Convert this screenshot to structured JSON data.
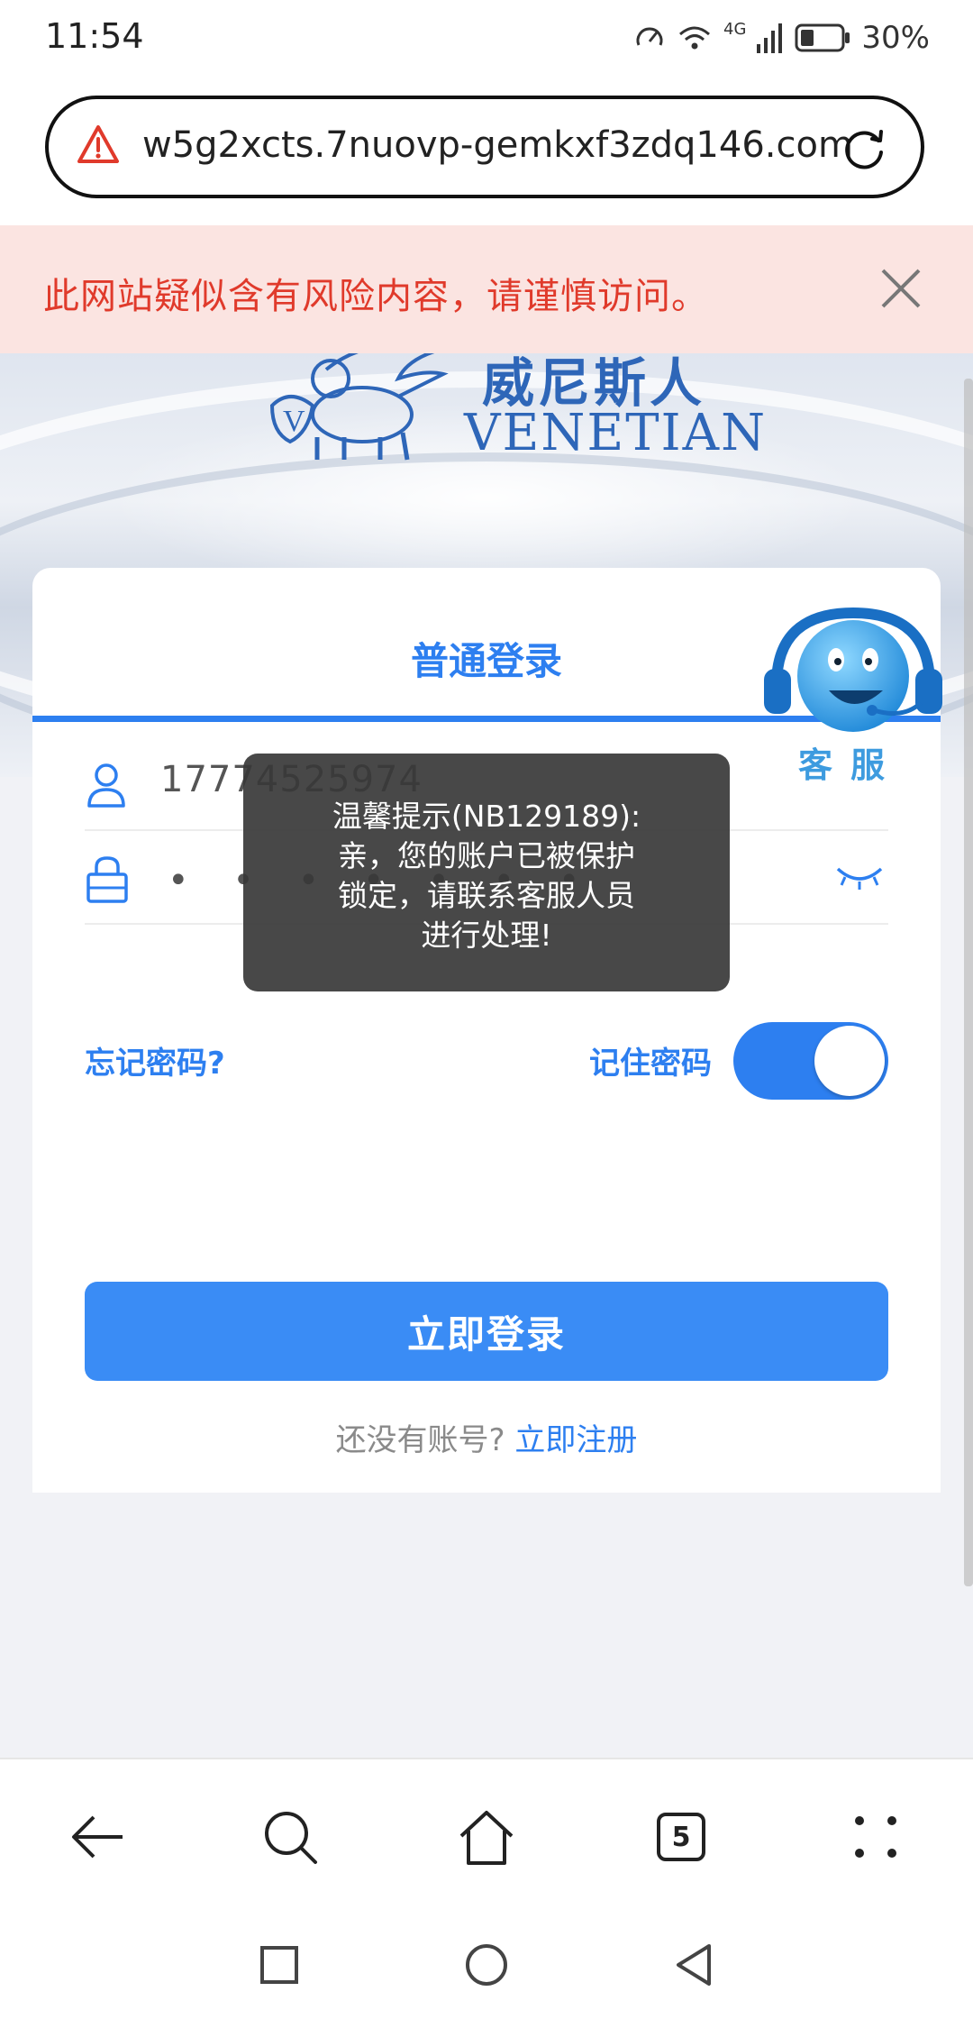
{
  "status_bar": {
    "time": "11:54",
    "network": "4G",
    "battery": "30%"
  },
  "url_bar": {
    "url": "w5g2xcts.7nuovp-gemkxf3zdq146.com"
  },
  "warning_banner": {
    "text": "此网站疑似含有风险内容，请谨慎访问。"
  },
  "logo": {
    "cn": "威尼斯人",
    "en": "VENETIAN"
  },
  "login": {
    "tab_title": "普通登录",
    "username": "17774525974",
    "password_dots": "• • • • • • •",
    "forgot_password": "忘记密码?",
    "remember_password": "记住密码",
    "remember_on": true,
    "login_button": "立即登录",
    "no_account": "还没有账号? ",
    "register_link": "立即注册"
  },
  "customer_service": {
    "label": "客服"
  },
  "toast": {
    "line1": "温馨提示(NB129189):",
    "line2": "亲，您的账户已被保护",
    "line3": "锁定，请联系客服人员",
    "line4": "进行处理!"
  },
  "toolbar": {
    "tab_count": "5"
  },
  "colors": {
    "accent": "#2d7ff0",
    "warning": "#e03a2b",
    "warning_bg": "#fbe4e1"
  }
}
